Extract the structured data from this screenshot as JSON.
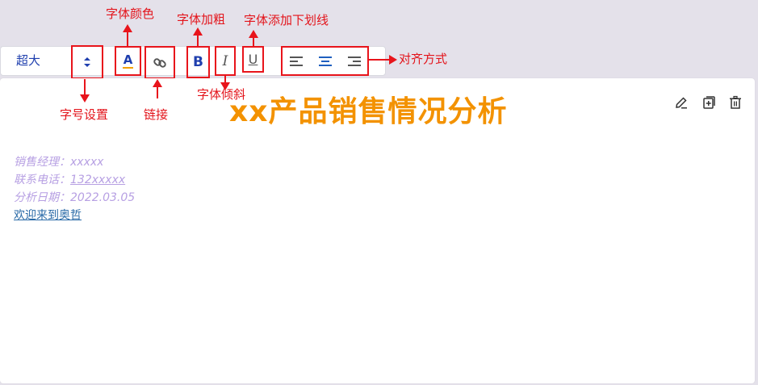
{
  "toolbar": {
    "font_size_value": "超大",
    "font_color_glyph": "A",
    "bold_glyph": "B",
    "italic_glyph": "I",
    "underline_glyph": "U"
  },
  "annotations": {
    "font_color": "字体颜色",
    "bold": "字体加粗",
    "underline": "字体添加下划线",
    "align": "对齐方式",
    "font_size": "字号设置",
    "link": "链接",
    "italic": "字体倾斜"
  },
  "content": {
    "title": "xx产品销售情况分析",
    "manager": "销售经理：xxxxx",
    "phone_label": "联系电话：",
    "phone_value": "132xxxxx",
    "date": "分析日期：2022.03.05",
    "welcome_link": "欢迎来到奥哲"
  },
  "colors": {
    "accent": "#1f3fae",
    "annotation_red": "#e8141b",
    "title_orange": "#f39200",
    "meta_purple": "#b7a0e3",
    "link_blue": "#2a6aa7"
  },
  "icons": [
    "font-color-icon",
    "link-icon",
    "bold-icon",
    "italic-icon",
    "underline-icon",
    "align-left-icon",
    "align-center-icon",
    "align-right-icon",
    "edit-icon",
    "copy-add-icon",
    "trash-icon",
    "select-arrows-icon"
  ]
}
